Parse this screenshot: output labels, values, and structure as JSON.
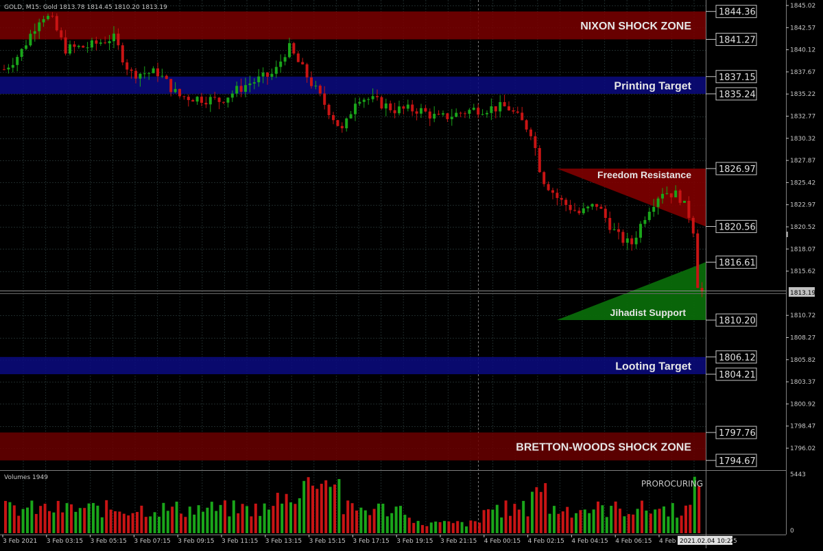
{
  "header": {
    "symbol_info": "GOLD, M15:  Gold  1813.78 1814.45 1810.20 1813.19"
  },
  "price_axis": {
    "ticks": [
      "1845.02",
      "1842.57",
      "1840.12",
      "1837.67",
      "1835.22",
      "1832.77",
      "1830.32",
      "1827.87",
      "1825.42",
      "1822.97",
      "1820.52",
      "1818.07",
      "1815.62",
      "1810.72",
      "1808.27",
      "1805.82",
      "1803.37",
      "1800.92",
      "1798.47",
      "1796.02"
    ],
    "current_price": "1813.19",
    "current_price_ghost": "1813.78"
  },
  "zones": [
    {
      "label": "NIXON SHOCK ZONE",
      "top": "1844.36",
      "bottom": "1841.27",
      "color": "#7a0000"
    },
    {
      "label": "Printing Target",
      "top": "1837.15",
      "bottom": "1835.24",
      "color": "#0a0a80"
    },
    {
      "label": "Looting Target",
      "top": "1806.12",
      "bottom": "1804.21",
      "color": "#0a0a80"
    },
    {
      "label": "BRETTON-WOODS SHOCK ZONE",
      "top": "1797.76",
      "bottom": "1794.67",
      "color": "#6a0000"
    }
  ],
  "triangles": [
    {
      "label": "Freedom Resistance",
      "level": "1826.97",
      "level2": "1820.56",
      "color": "#800000"
    },
    {
      "label": "Jihadist Support",
      "level": "1816.61",
      "level2": "1810.20",
      "color": "#0a6a0a"
    }
  ],
  "volume_panel": {
    "title": "Volumes 1949",
    "max_label": "5443",
    "zero_label": "0",
    "indicator_label": "PROROCURING"
  },
  "time_axis": {
    "labels": [
      "3 Feb 2021",
      "3 Feb 03:15",
      "3 Feb 05:15",
      "3 Feb 07:15",
      "3 Feb 09:15",
      "3 Feb 11:15",
      "3 Feb 13:15",
      "3 Feb 15:15",
      "3 Feb 17:15",
      "3 Feb 19:15",
      "3 Feb 21:15",
      "4 Feb 00:15",
      "4 Feb 02:15",
      "4 Feb 04:15",
      "4 Feb 06:15",
      "4 Feb"
    ],
    "cursor_label": "2021.02.04 10:22",
    "cursor_suffix": "5"
  },
  "colors": {
    "bull": "#1aa51a",
    "bear": "#c81414",
    "grid": "#2a3a3a",
    "panel_border": "#707070"
  }
}
